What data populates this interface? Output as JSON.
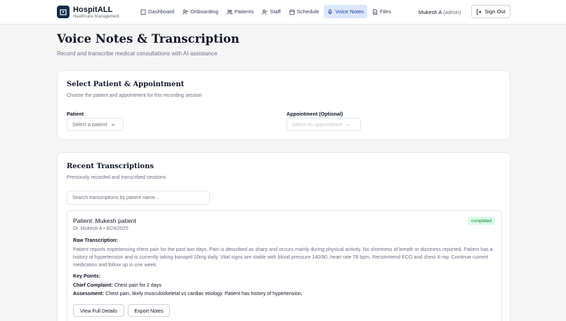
{
  "brand": {
    "name": "HospitALL",
    "subtitle": "Healthcare Management"
  },
  "nav": [
    {
      "label": "Dashboard",
      "icon": "building-icon",
      "active": false
    },
    {
      "label": "Onboarding",
      "icon": "user-plus-icon",
      "active": false
    },
    {
      "label": "Patients",
      "icon": "users-icon",
      "active": false
    },
    {
      "label": "Staff",
      "icon": "user-check-icon",
      "active": false
    },
    {
      "label": "Schedule",
      "icon": "calendar-icon",
      "active": false
    },
    {
      "label": "Voice Notes",
      "icon": "mic-icon",
      "active": true
    },
    {
      "label": "Files",
      "icon": "file-icon",
      "active": false
    }
  ],
  "user": {
    "name": "Mukesh A",
    "role": "(admin)"
  },
  "signout_label": "Sign Out",
  "page": {
    "title": "Voice Notes & Transcription",
    "subtitle": "Record and transcribe medical consultations with AI assistance"
  },
  "select_card": {
    "title": "Select Patient & Appointment",
    "subtitle": "Choose the patient and appointment for this recording session",
    "patient_label": "Patient",
    "patient_placeholder": "Select a patient",
    "appointment_label": "Appointment (Optional)",
    "appointment_placeholder": "Select an appointment"
  },
  "recent_card": {
    "title": "Recent Transcriptions",
    "subtitle": "Previously recorded and transcribed sessions",
    "search_placeholder": "Search transcriptions by patient name...",
    "items": [
      {
        "patient": "Patient: Mukesh patient",
        "meta": "Dr. Mukesh A • 8/24/2025",
        "status": "completed",
        "raw_label": "Raw Transcription:",
        "raw_text": "Patient reports experiencing chest pain for the past two days. Pain is described as sharp and occurs mainly during physical activity. No shortness of breath or dizziness reported. Patient has a history of hypertension and is currently taking lisinopril 10mg daily. Vital signs are stable with blood pressure 140/90, heart rate 78 bpm. Recommend ECG and chest X-ray. Continue current medication and follow up in one week.",
        "key_points_label": "Key Points:",
        "chief_complaint_label": "Chief Complaint:",
        "chief_complaint": "Chest pain for 2 days",
        "assessment_label": "Assessment:",
        "assessment": "Chest pain, likely musculoskeletal vs cardiac etiology. Patient has history of hypertension.",
        "view_label": "View Full Details",
        "export_label": "Export Notes"
      }
    ]
  },
  "colors": {
    "accent": "#1e40af",
    "active_bg": "#dbe7fb",
    "badge_bg": "#dcfce7",
    "badge_text": "#15803d",
    "logo": "#0f2a4a"
  }
}
